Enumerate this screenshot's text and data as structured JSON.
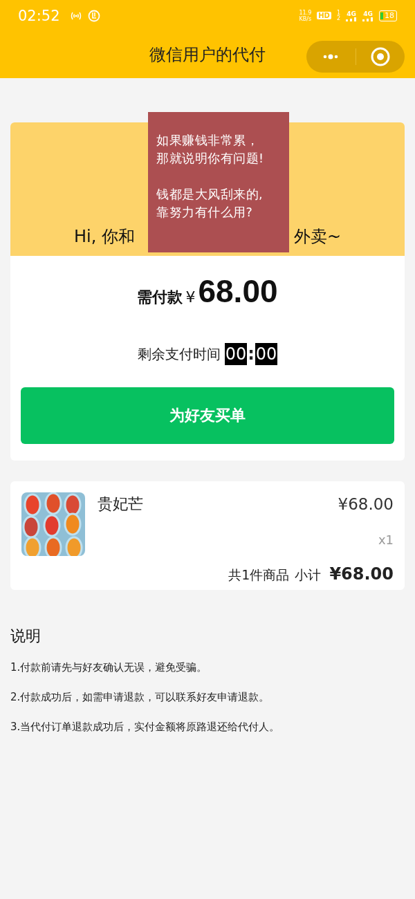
{
  "status_bar": {
    "time": "02:52",
    "net_speed": "11.9",
    "net_unit": "KB/s",
    "hd": "HD",
    "sim_1": "1",
    "sim_2": "2",
    "network_1": "4G",
    "network_2": "4G",
    "battery": "18"
  },
  "header": {
    "title": "微信用户的代付"
  },
  "banner": {
    "greeting_start": "Hi, 你和",
    "greeting_end": "外卖~"
  },
  "note": {
    "lines": [
      "如果赚钱非常累，",
      "那就说明你有问题!",
      "钱都是大风刮来的,",
      "靠努力有什么用?"
    ]
  },
  "payment": {
    "label": "需付款",
    "currency": "¥",
    "amount": "68.00",
    "timer_label": "剩余支付时间",
    "minutes": "00",
    "separator": ":",
    "seconds": "00",
    "button": "为好友买单"
  },
  "order": {
    "items": [
      {
        "kind": "picture",
        "name": "贵妃芒",
        "price": "¥68.00",
        "quantity": "x1"
      }
    ],
    "summary": "共1件商品",
    "subtotal_label": "小计",
    "subtotal": "¥68.00"
  },
  "notes": {
    "title": "说明",
    "items": [
      "1.付款前请先与好友确认无误，避免受骗。",
      "2.付款成功后，如需申请退款，可以联系好友申请退款。",
      "3.当代付订单退款成功后，实付金额将原路退还给代付人。"
    ]
  }
}
